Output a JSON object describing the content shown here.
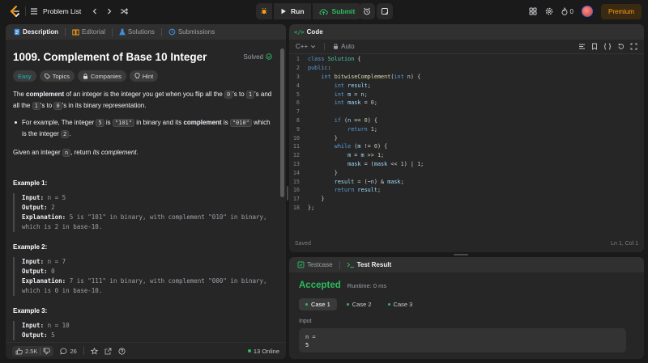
{
  "topbar": {
    "problem_list": "Problem List",
    "run": "Run",
    "submit": "Submit",
    "streak": "0",
    "premium": "Premium"
  },
  "desc": {
    "tabs": [
      "Description",
      "Editorial",
      "Solutions",
      "Submissions"
    ],
    "title": "1009. Complement of Base 10 Integer",
    "status": "Solved",
    "tags": [
      "Easy",
      "Topics",
      "Companies",
      "Hint"
    ],
    "p1": {
      "a": "The ",
      "b": "complement",
      "c": " of an integer is the integer you get when you flip all the ",
      "d": "0",
      "e": "'s to ",
      "f": "1",
      "g": "'s and all the ",
      "h": "1",
      "i": "'s to ",
      "j": "0",
      "k": "'s in its binary representation."
    },
    "bullet": {
      "a": "For example, The integer ",
      "b": "5",
      "c": " is ",
      "d": "\"101\"",
      "e": " in binary and its ",
      "f": "complement",
      "g": " is ",
      "h": "\"010\"",
      "i": " which is the integer ",
      "j": "2",
      "k": "."
    },
    "p2": {
      "a": "Given an integer ",
      "b": "n",
      "c": ", return ",
      "d": "its complement",
      "e": "."
    },
    "examples": [
      {
        "title": "Example 1:",
        "input": "n = 5",
        "output": "2",
        "explanation": "5 is \"101\" in binary, with complement \"010\" in binary, which is 2 in base-10."
      },
      {
        "title": "Example 2:",
        "input": "n = 7",
        "output": "0",
        "explanation": "7 is \"111\" in binary, with complement \"000\" in binary, which is 0 in base-10."
      },
      {
        "title": "Example 3:",
        "input": "n = 10",
        "output": "5"
      }
    ],
    "labels": {
      "input": "Input:",
      "output": "Output:",
      "explanation": "Explanation:"
    },
    "footer": {
      "likes": "2.5K",
      "comments": "26",
      "online": "13 Online"
    }
  },
  "code": {
    "tab": "Code",
    "language": "C++",
    "mode": "Auto",
    "status": "Saved",
    "cursor": "Ln 1, Col 1"
  },
  "result": {
    "tabs": [
      "Testcase",
      "Test Result"
    ],
    "verdict": "Accepted",
    "runtime": "Runtime: 0 ms",
    "cases": [
      "Case 1",
      "Case 2",
      "Case 3"
    ],
    "input_label": "Input",
    "input_var": "n =",
    "input_val": "5"
  }
}
